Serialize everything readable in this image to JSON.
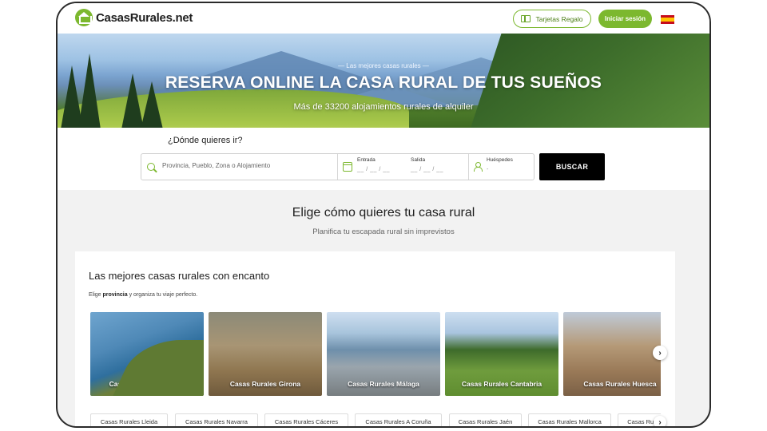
{
  "header": {
    "logo_text": "CasasRurales.net",
    "gift_label": "Tarjetas Regalo",
    "login_label": "Iniciar sesión",
    "language_icon": "flag-spain-icon"
  },
  "hero": {
    "kicker": "— Las mejores casas rurales —",
    "title": "RESERVA ONLINE LA CASA RURAL DE TUS SUEÑOS",
    "count_text": "Más de 33200 alojamientos rurales de alquiler"
  },
  "search": {
    "question": "¿Dónde quieres ir?",
    "destination_placeholder": "Provincia, Pueblo, Zona o Alojamiento",
    "checkin_label": "Entrada",
    "checkin_value": "__ / __ / __",
    "checkout_label": "Salida",
    "checkout_value": "__ / __ / __",
    "guests_label": "Huéspedes",
    "guests_value": "-",
    "button_label": "BUSCAR"
  },
  "intro": {
    "title": "Elige cómo quieres tu casa rural",
    "subtitle": "Planifica tu escapada rural sin imprevistos"
  },
  "provinces_card": {
    "title": "Las mejores casas rurales con encanto",
    "subtitle_before": "Elige ",
    "subtitle_bold": "provincia",
    "subtitle_after": " y organiza tu viaje perfecto.",
    "photos": [
      {
        "label": "Casas Rurales Asturias"
      },
      {
        "label": "Casas Rurales Girona"
      },
      {
        "label": "Casas Rurales Málaga"
      },
      {
        "label": "Casas Rurales Cantabria"
      },
      {
        "label": "Casas Rurales Huesca"
      }
    ],
    "chips": [
      "Casas Rurales Lleida",
      "Casas Rurales Navarra",
      "Casas Rurales Cáceres",
      "Casas Rurales A Coruña",
      "Casas Rurales Jaén",
      "Casas Rurales Mallorca",
      "Casas Rurales Ávila"
    ],
    "next_icon": "›"
  },
  "colors": {
    "brand_green": "#7cb82f",
    "search_button": "#000000"
  }
}
